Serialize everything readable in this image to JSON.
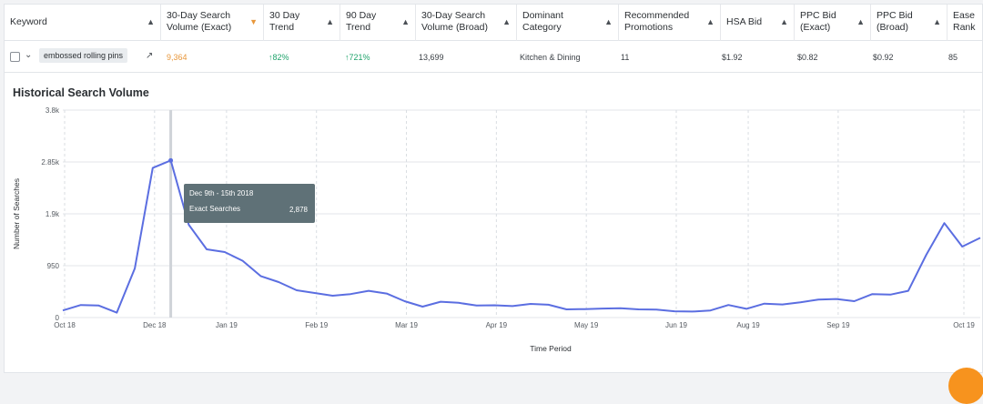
{
  "table": {
    "columns": [
      {
        "label": "Keyword",
        "sorted": false
      },
      {
        "label": "30-Day Search Volume (Exact)",
        "sorted": true
      },
      {
        "label": "30 Day Trend",
        "sorted": false
      },
      {
        "label": "90 Day Trend",
        "sorted": false
      },
      {
        "label": "30-Day Search Volume (Broad)",
        "sorted": false
      },
      {
        "label": "Dominant Category",
        "sorted": false
      },
      {
        "label": "Recommended Promotions",
        "sorted": false
      },
      {
        "label": "HSA Bid",
        "sorted": false
      },
      {
        "label": "PPC Bid (Exact)",
        "sorted": false
      },
      {
        "label": "PPC Bid (Broad)",
        "sorted": false
      },
      {
        "label": "Ease Rank",
        "sorted": false
      }
    ],
    "row": {
      "keyword": "embossed rolling pins",
      "search_volume_exact": "9,364",
      "trend_30": "82%",
      "trend_90": "721%",
      "search_volume_broad": "13,699",
      "dominant_category": "Kitchen & Dining",
      "recommended_promotions": "11",
      "hsa_bid": "$1.92",
      "ppc_exact": "$0.82",
      "ppc_broad": "$0.92",
      "ease_rank": "85"
    }
  },
  "chart_title": "Historical Search Volume",
  "tooltip": {
    "date": "Dec 9th - 15th 2018",
    "label": "Exact Searches",
    "value": "2,878"
  },
  "chart_data": {
    "type": "line",
    "title": "Historical Search Volume",
    "xlabel": "Time Period",
    "ylabel": "Number of Searches",
    "ylim": [
      0,
      3800
    ],
    "y_ticks": [
      "0",
      "950",
      "1.9k",
      "2.85k",
      "3.8k"
    ],
    "x_ticks": [
      "Oct 18",
      "Dec 18",
      "Jan 19",
      "Feb 19",
      "Mar 19",
      "Apr 19",
      "May 19",
      "Jun 19",
      "Aug 19",
      "Sep 19",
      "Oct 19"
    ],
    "series": [
      {
        "values": [
          130,
          230,
          220,
          90,
          900,
          2740,
          2878,
          1700,
          1250,
          1200,
          1040,
          760,
          650,
          500,
          450,
          400,
          430,
          490,
          440,
          300,
          200,
          290,
          270,
          220,
          225,
          210,
          250,
          235,
          150,
          155,
          165,
          170,
          150,
          145,
          115,
          110,
          130,
          230,
          160,
          255,
          240,
          280,
          330,
          340,
          300,
          430,
          420,
          490,
          1150,
          1730,
          1300,
          1460
        ]
      }
    ],
    "highlight_index": 6,
    "color": "#5b6ee1"
  }
}
